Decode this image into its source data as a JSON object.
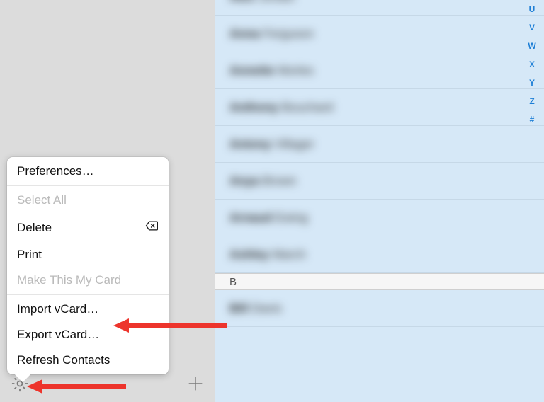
{
  "sidebar": {
    "gear": "gear",
    "plus": "plus"
  },
  "menu": {
    "preferences": "Preferences…",
    "select_all": "Select All",
    "delete": "Delete",
    "print": "Print",
    "make_card": "Make This My Card",
    "import_vcard": "Import vCard…",
    "export_vcard": "Export vCard…",
    "refresh": "Refresh Contacts"
  },
  "contacts": {
    "rows": [
      {
        "first": "Alex",
        "last": "Jordan"
      },
      {
        "first": "Anna",
        "last": "Ferguson"
      },
      {
        "first": "Annette",
        "last": "Morles"
      },
      {
        "first": "Anthony",
        "last": "Bouchard"
      },
      {
        "first": "Antony",
        "last": "Villager"
      },
      {
        "first": "Anya",
        "last": "Brown"
      },
      {
        "first": "Arnaud",
        "last": "Ewing"
      },
      {
        "first": "Ashley",
        "last": "March"
      }
    ],
    "section_b": "B",
    "row_b": {
      "first": "Bill",
      "last": "Davis"
    }
  },
  "index": [
    "U",
    "V",
    "W",
    "X",
    "Y",
    "Z",
    "#"
  ]
}
